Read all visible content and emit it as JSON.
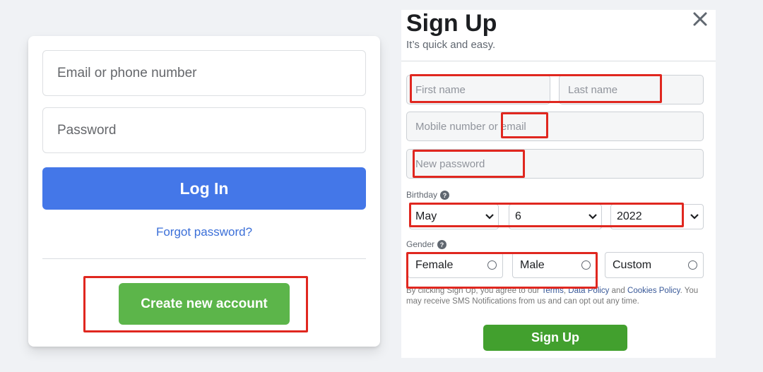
{
  "login": {
    "email_placeholder": "Email or phone number",
    "password_placeholder": "Password",
    "login_label": "Log In",
    "forgot_label": "Forgot password?",
    "create_label": "Create new account"
  },
  "signup": {
    "title": "Sign Up",
    "subtitle": "It’s quick and easy.",
    "first_name_placeholder": "First name",
    "last_name_placeholder": "Last name",
    "mobile_placeholder": "Mobile number or email",
    "password_placeholder": "New password",
    "birthday_label": "Birthday",
    "birthday": {
      "month": "May",
      "day": "6",
      "year": "2022"
    },
    "gender_label": "Gender",
    "gender_options": [
      "Female",
      "Male",
      "Custom"
    ],
    "terms": {
      "part1": "By clicking Sign Up, you agree to our ",
      "terms_link": "Terms",
      "sep1": ", ",
      "data_link": "Data Policy",
      "part2": " and ",
      "cookies_link": "Cookies Policy",
      "part3": ". You may receive SMS Notifications from us and can opt out any time."
    },
    "submit_label": "Sign Up"
  },
  "colors": {
    "login_blue": "#4477e8",
    "create_green": "#5cb54a",
    "signup_green": "#42a02e",
    "annotation_red": "#e0271f"
  },
  "icons": [
    "close-icon",
    "help-icon",
    "chevron-down-icon"
  ]
}
